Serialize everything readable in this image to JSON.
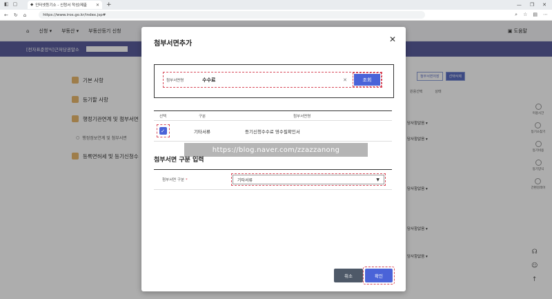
{
  "browser": {
    "tab_title": "인터넷등기소 - 신청서 작성/제출",
    "url": "https://www.iros.go.kr/index.jsp#"
  },
  "site": {
    "nav": [
      "신청",
      "부동산",
      "부동산등기 신청"
    ],
    "help_label": "도움말",
    "office_label": "[전자표준양식]근저당권말소"
  },
  "leftnav": {
    "items": [
      {
        "label": "기본 사항"
      },
      {
        "label": "등기할 사항"
      },
      {
        "label": "행정기관연계 및 첨부서면"
      }
    ],
    "sub_item": "행정정보연계 및 첨부서면",
    "last_item": "등록면허세 및 등기신청수"
  },
  "bg": {
    "btn_save": "첨부서면저장",
    "btn_delete": "선택삭제",
    "col_select": "원용선택",
    "col_status": "상태",
    "sel_value": "당사항없음"
  },
  "rail": [
    "이용시간",
    "등기소찾기",
    "등기비용",
    "등기양식",
    "간편검색어"
  ],
  "modal": {
    "title": "첨부서면추가",
    "search_label": "첨부서면명",
    "search_value": "수수료",
    "search_button": "조회",
    "table_headers": [
      "선택",
      "구분",
      "첨부서면명"
    ],
    "row": {
      "category": "기타서류",
      "name": "등기신청수수료 영수필확인서"
    },
    "watermark": "https://blog.naver.com/zzazzanong",
    "section_title": "첨부서면 구분 입력",
    "type_label": "첨부서면 구분",
    "type_required": "*",
    "type_value": "기타서류",
    "cancel": "취소",
    "confirm": "확인"
  }
}
